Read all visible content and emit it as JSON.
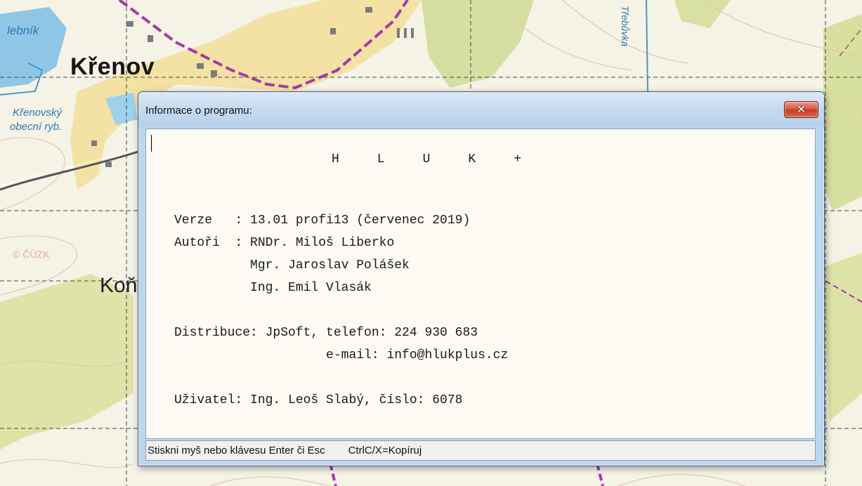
{
  "map": {
    "labels": {
      "town_main": "Křenov",
      "town_partial": "Koň",
      "water_partial": "lebník",
      "pond_line1": "Křenovský",
      "pond_line2": "obecní ryb.",
      "cuzk_mark": "© ČÚZK",
      "stream": "Třebůvka"
    }
  },
  "window": {
    "title": "Informace o programu:",
    "close_icon": "close-x-icon",
    "close_glyph": "✕",
    "lines": [
      "     H    L    U    K    +",
      "",
      "Verze   : 13.01 profi13 (červenec 2019)",
      "Autoři  : RNDr. Miloš Liberko",
      "          Mgr. Jaroslav Polášek",
      "          Ing. Emil Vlasák",
      "",
      "Distribuce: JpSoft, telefon: 224 930 683",
      "                    e-mail: info@hlukplus.cz",
      "",
      "Uživatel: Ing. Leoš Slabý, číslo: 6078"
    ],
    "status": {
      "left": "Stiskni myš nebo klávesu Enter či Esc",
      "right": "CtrlC/X=Kopíruj"
    }
  }
}
